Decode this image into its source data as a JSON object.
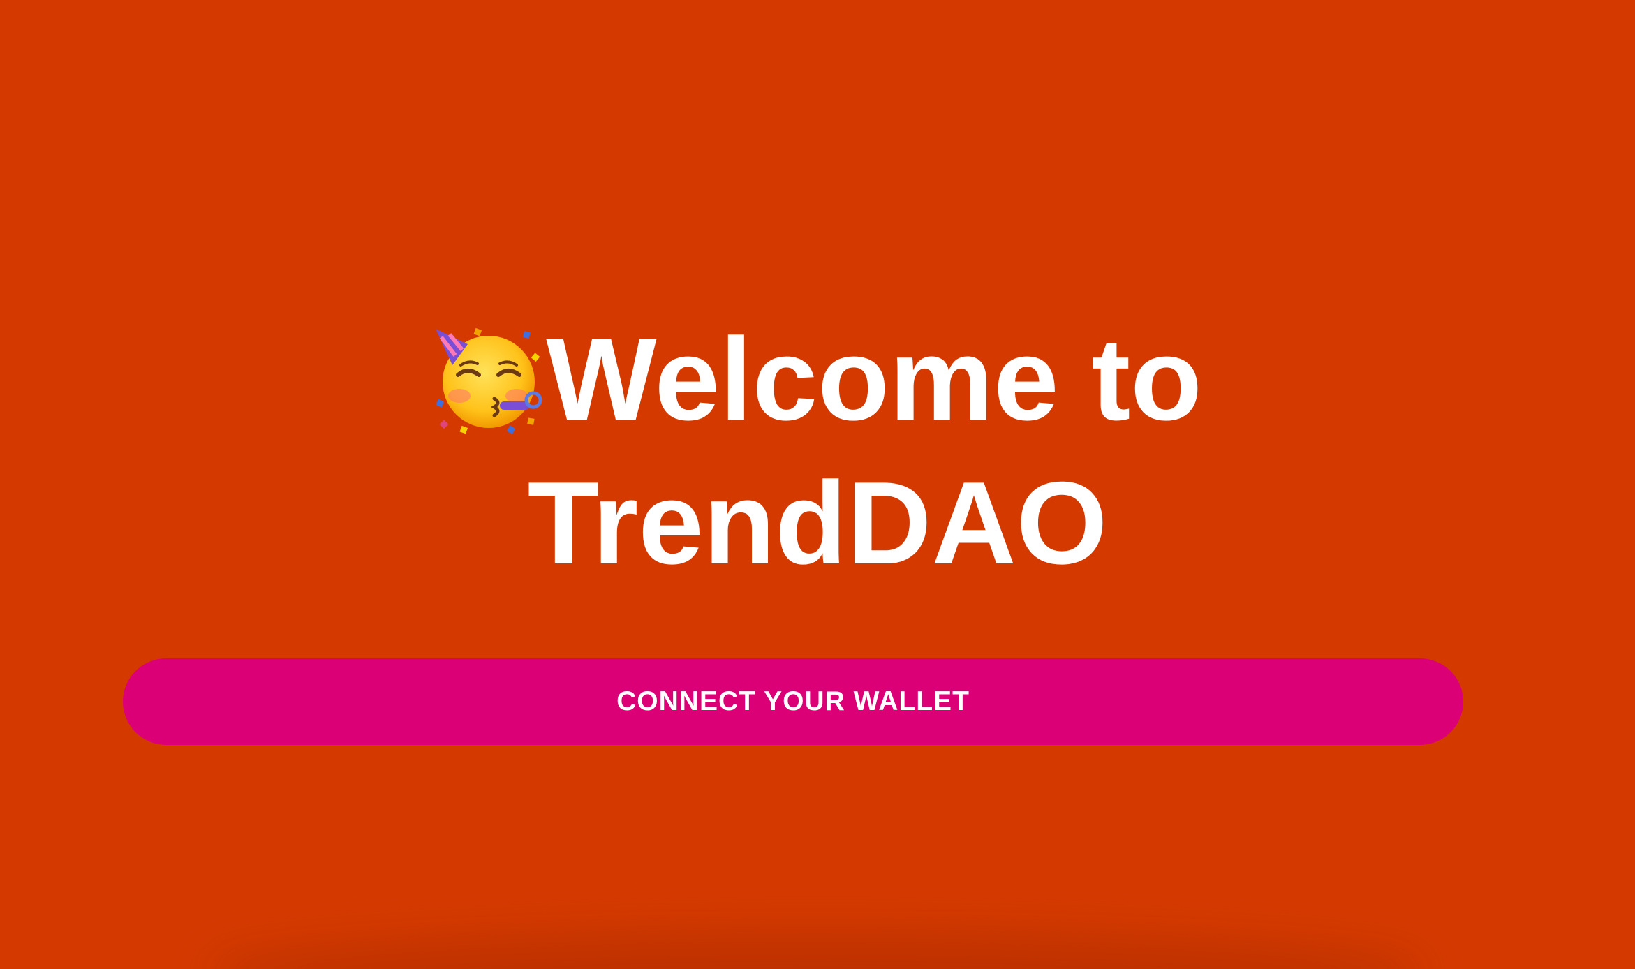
{
  "hero": {
    "emoji_icon": "partying-face-icon",
    "title_line_1": "Welcome to",
    "title_line_2": "TrendDAO"
  },
  "actions": {
    "connect_label": "CONNECT YOUR WALLET"
  },
  "colors": {
    "background": "#d43a00",
    "button": "#dc0077",
    "text": "#ffffff"
  }
}
